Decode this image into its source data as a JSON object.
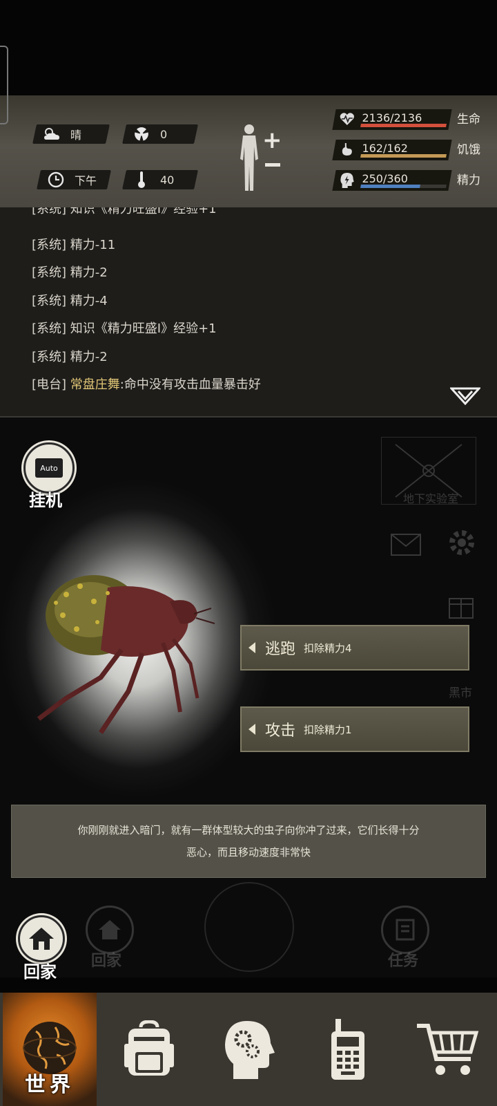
{
  "status": {
    "weather": "晴",
    "radiation": "0",
    "time_of_day": "下午",
    "temperature": "40"
  },
  "vitals": [
    {
      "label": "生命",
      "value": "2136/2136",
      "fraction": 1.0,
      "color": "#d2503c",
      "icon": "heart-pulse-icon"
    },
    {
      "label": "饥饿",
      "value": "162/162",
      "fraction": 1.0,
      "color": "#c49a55",
      "icon": "stomach-icon"
    },
    {
      "label": "精力",
      "value": "250/360",
      "fraction": 0.694,
      "color": "#4f7fbf",
      "icon": "energy-head-icon"
    }
  ],
  "log": {
    "lines": [
      {
        "tag": "[系统]",
        "text": "知识《精力旺盛Ⅰ》经验+1"
      },
      {
        "tag": "[系统]",
        "text": "精力-11"
      },
      {
        "tag": "[系统]",
        "text": "精力-2"
      },
      {
        "tag": "[系统]",
        "text": "精力-4"
      },
      {
        "tag": "[系统]",
        "text": "知识《精力旺盛Ⅰ》经验+1"
      },
      {
        "tag": "[系统]",
        "text": "精力-2"
      }
    ],
    "radio": {
      "tag": "[电台]",
      "speaker": "常盘庄舞",
      "text": ":命中没有攻击血量暴击好"
    }
  },
  "scene": {
    "auto_label": "挂机",
    "auto_icon_text": "Auto",
    "map_label": "地下实验室",
    "side_label_black_market": "黑市",
    "actions": [
      {
        "label": "逃跑",
        "cost": "扣除精力4"
      },
      {
        "label": "攻击",
        "cost": "扣除精力1"
      }
    ],
    "description_line1": "你刚刚就进入暗门，就有一群体型较大的虫子向你冲了过来，它们长得十分",
    "description_line2": "恶心，而且移动速度非常快",
    "home_label": "回家",
    "ghost_home_label": "回家",
    "ghost_task_label": "任务"
  },
  "nav": {
    "items": [
      {
        "label": "世界",
        "icon": "globe-icon",
        "active": true
      },
      {
        "label": "",
        "icon": "backpack-icon",
        "active": false
      },
      {
        "label": "",
        "icon": "brain-skills-icon",
        "active": false
      },
      {
        "label": "",
        "icon": "radio-phone-icon",
        "active": false
      },
      {
        "label": "",
        "icon": "shopping-cart-icon",
        "active": false
      }
    ]
  }
}
